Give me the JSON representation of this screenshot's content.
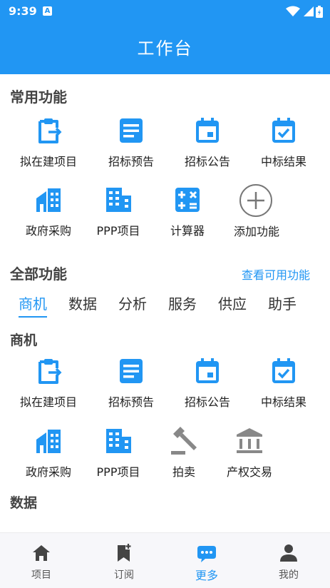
{
  "status": {
    "time": "9:39",
    "indicator": "A"
  },
  "header": {
    "title": "工作台"
  },
  "common": {
    "title": "常用功能",
    "items": [
      {
        "label": "拟在建项目",
        "icon": "clipboard-arrow-icon"
      },
      {
        "label": "招标预告",
        "icon": "document-lines-icon"
      },
      {
        "label": "招标公告",
        "icon": "calendar-icon"
      },
      {
        "label": "中标结果",
        "icon": "calendar-check-icon"
      },
      {
        "label": "政府采购",
        "icon": "government-building-icon"
      },
      {
        "label": "PPP项目",
        "icon": "office-building-icon"
      },
      {
        "label": "计算器",
        "icon": "calculator-icon"
      },
      {
        "label": "添加功能",
        "icon": "add-circle-icon"
      }
    ]
  },
  "all": {
    "title": "全部功能",
    "link": "查看可用功能"
  },
  "tabs": [
    "商机",
    "数据",
    "分析",
    "服务",
    "供应",
    "助手"
  ],
  "shangji": {
    "title": "商机",
    "items": [
      {
        "label": "拟在建项目",
        "icon": "clipboard-arrow-icon"
      },
      {
        "label": "招标预告",
        "icon": "document-lines-icon"
      },
      {
        "label": "招标公告",
        "icon": "calendar-icon"
      },
      {
        "label": "中标结果",
        "icon": "calendar-check-icon"
      },
      {
        "label": "政府采购",
        "icon": "government-building-icon"
      },
      {
        "label": "PPP项目",
        "icon": "office-building-icon"
      },
      {
        "label": "拍卖",
        "icon": "gavel-icon"
      },
      {
        "label": "产权交易",
        "icon": "bank-icon"
      }
    ]
  },
  "shuju": {
    "title": "数据"
  },
  "nav": [
    {
      "label": "项目",
      "icon": "home-icon"
    },
    {
      "label": "订阅",
      "icon": "bookmark-add-icon"
    },
    {
      "label": "更多",
      "icon": "more-chat-icon"
    },
    {
      "label": "我的",
      "icon": "person-icon"
    }
  ],
  "colors": {
    "primary": "#2196f3",
    "gray_icon": "#888888"
  }
}
